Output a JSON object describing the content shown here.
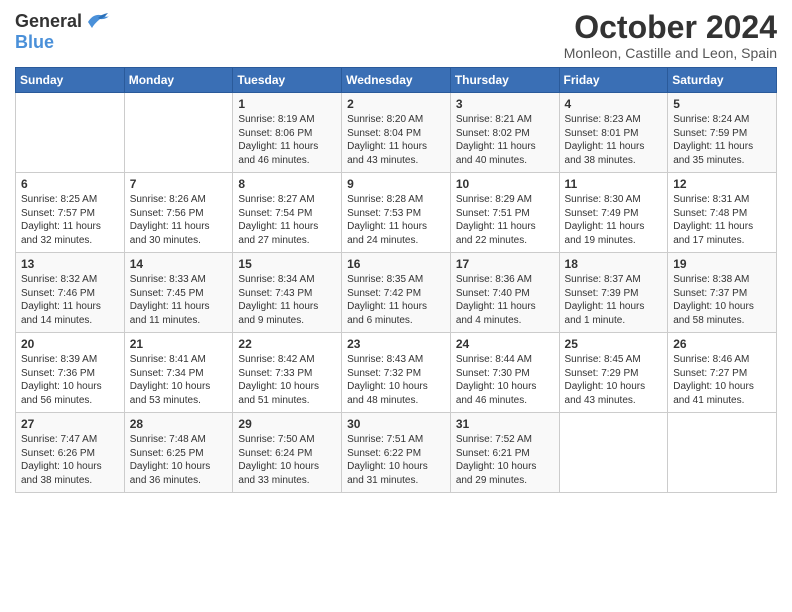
{
  "header": {
    "logo_general": "General",
    "logo_blue": "Blue",
    "month_title": "October 2024",
    "subtitle": "Monleon, Castille and Leon, Spain"
  },
  "days_of_week": [
    "Sunday",
    "Monday",
    "Tuesday",
    "Wednesday",
    "Thursday",
    "Friday",
    "Saturday"
  ],
  "weeks": [
    [
      {
        "day": "",
        "info": ""
      },
      {
        "day": "",
        "info": ""
      },
      {
        "day": "1",
        "info": "Sunrise: 8:19 AM\nSunset: 8:06 PM\nDaylight: 11 hours and 46 minutes."
      },
      {
        "day": "2",
        "info": "Sunrise: 8:20 AM\nSunset: 8:04 PM\nDaylight: 11 hours and 43 minutes."
      },
      {
        "day": "3",
        "info": "Sunrise: 8:21 AM\nSunset: 8:02 PM\nDaylight: 11 hours and 40 minutes."
      },
      {
        "day": "4",
        "info": "Sunrise: 8:23 AM\nSunset: 8:01 PM\nDaylight: 11 hours and 38 minutes."
      },
      {
        "day": "5",
        "info": "Sunrise: 8:24 AM\nSunset: 7:59 PM\nDaylight: 11 hours and 35 minutes."
      }
    ],
    [
      {
        "day": "6",
        "info": "Sunrise: 8:25 AM\nSunset: 7:57 PM\nDaylight: 11 hours and 32 minutes."
      },
      {
        "day": "7",
        "info": "Sunrise: 8:26 AM\nSunset: 7:56 PM\nDaylight: 11 hours and 30 minutes."
      },
      {
        "day": "8",
        "info": "Sunrise: 8:27 AM\nSunset: 7:54 PM\nDaylight: 11 hours and 27 minutes."
      },
      {
        "day": "9",
        "info": "Sunrise: 8:28 AM\nSunset: 7:53 PM\nDaylight: 11 hours and 24 minutes."
      },
      {
        "day": "10",
        "info": "Sunrise: 8:29 AM\nSunset: 7:51 PM\nDaylight: 11 hours and 22 minutes."
      },
      {
        "day": "11",
        "info": "Sunrise: 8:30 AM\nSunset: 7:49 PM\nDaylight: 11 hours and 19 minutes."
      },
      {
        "day": "12",
        "info": "Sunrise: 8:31 AM\nSunset: 7:48 PM\nDaylight: 11 hours and 17 minutes."
      }
    ],
    [
      {
        "day": "13",
        "info": "Sunrise: 8:32 AM\nSunset: 7:46 PM\nDaylight: 11 hours and 14 minutes."
      },
      {
        "day": "14",
        "info": "Sunrise: 8:33 AM\nSunset: 7:45 PM\nDaylight: 11 hours and 11 minutes."
      },
      {
        "day": "15",
        "info": "Sunrise: 8:34 AM\nSunset: 7:43 PM\nDaylight: 11 hours and 9 minutes."
      },
      {
        "day": "16",
        "info": "Sunrise: 8:35 AM\nSunset: 7:42 PM\nDaylight: 11 hours and 6 minutes."
      },
      {
        "day": "17",
        "info": "Sunrise: 8:36 AM\nSunset: 7:40 PM\nDaylight: 11 hours and 4 minutes."
      },
      {
        "day": "18",
        "info": "Sunrise: 8:37 AM\nSunset: 7:39 PM\nDaylight: 11 hours and 1 minute."
      },
      {
        "day": "19",
        "info": "Sunrise: 8:38 AM\nSunset: 7:37 PM\nDaylight: 10 hours and 58 minutes."
      }
    ],
    [
      {
        "day": "20",
        "info": "Sunrise: 8:39 AM\nSunset: 7:36 PM\nDaylight: 10 hours and 56 minutes."
      },
      {
        "day": "21",
        "info": "Sunrise: 8:41 AM\nSunset: 7:34 PM\nDaylight: 10 hours and 53 minutes."
      },
      {
        "day": "22",
        "info": "Sunrise: 8:42 AM\nSunset: 7:33 PM\nDaylight: 10 hours and 51 minutes."
      },
      {
        "day": "23",
        "info": "Sunrise: 8:43 AM\nSunset: 7:32 PM\nDaylight: 10 hours and 48 minutes."
      },
      {
        "day": "24",
        "info": "Sunrise: 8:44 AM\nSunset: 7:30 PM\nDaylight: 10 hours and 46 minutes."
      },
      {
        "day": "25",
        "info": "Sunrise: 8:45 AM\nSunset: 7:29 PM\nDaylight: 10 hours and 43 minutes."
      },
      {
        "day": "26",
        "info": "Sunrise: 8:46 AM\nSunset: 7:27 PM\nDaylight: 10 hours and 41 minutes."
      }
    ],
    [
      {
        "day": "27",
        "info": "Sunrise: 7:47 AM\nSunset: 6:26 PM\nDaylight: 10 hours and 38 minutes."
      },
      {
        "day": "28",
        "info": "Sunrise: 7:48 AM\nSunset: 6:25 PM\nDaylight: 10 hours and 36 minutes."
      },
      {
        "day": "29",
        "info": "Sunrise: 7:50 AM\nSunset: 6:24 PM\nDaylight: 10 hours and 33 minutes."
      },
      {
        "day": "30",
        "info": "Sunrise: 7:51 AM\nSunset: 6:22 PM\nDaylight: 10 hours and 31 minutes."
      },
      {
        "day": "31",
        "info": "Sunrise: 7:52 AM\nSunset: 6:21 PM\nDaylight: 10 hours and 29 minutes."
      },
      {
        "day": "",
        "info": ""
      },
      {
        "day": "",
        "info": ""
      }
    ]
  ]
}
